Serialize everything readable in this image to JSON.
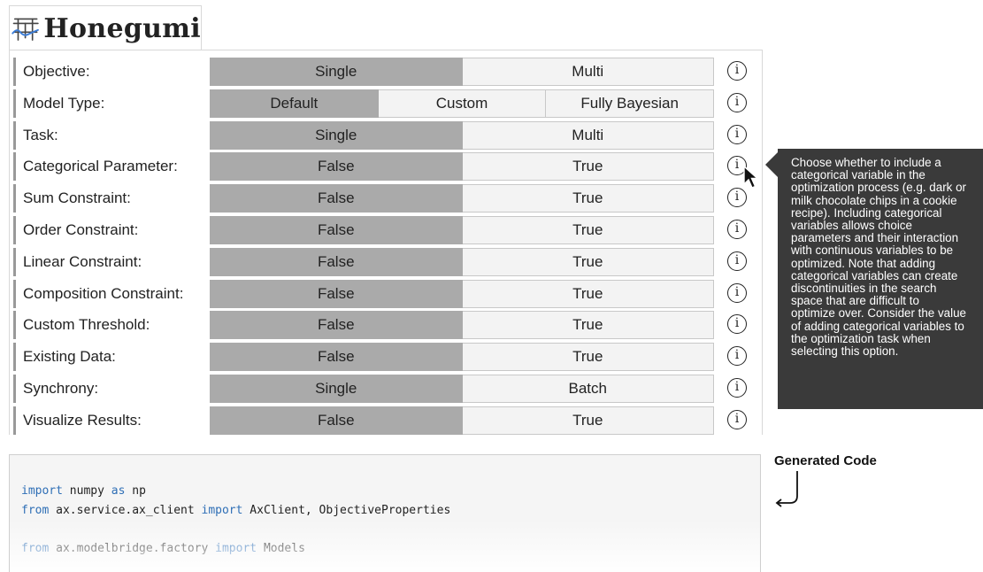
{
  "app": {
    "title": "Honegumi"
  },
  "options": [
    {
      "label": "Objective:",
      "choices": [
        "Single",
        "Multi"
      ],
      "selected": 0
    },
    {
      "label": "Model Type:",
      "choices": [
        "Default",
        "Custom",
        "Fully Bayesian"
      ],
      "selected": 0
    },
    {
      "label": "Task:",
      "choices": [
        "Single",
        "Multi"
      ],
      "selected": 0
    },
    {
      "label": "Categorical Parameter:",
      "choices": [
        "False",
        "True"
      ],
      "selected": 0
    },
    {
      "label": "Sum Constraint:",
      "choices": [
        "False",
        "True"
      ],
      "selected": 0
    },
    {
      "label": "Order Constraint:",
      "choices": [
        "False",
        "True"
      ],
      "selected": 0
    },
    {
      "label": "Linear Constraint:",
      "choices": [
        "False",
        "True"
      ],
      "selected": 0
    },
    {
      "label": "Composition Constraint:",
      "choices": [
        "False",
        "True"
      ],
      "selected": 0
    },
    {
      "label": "Custom Threshold:",
      "choices": [
        "False",
        "True"
      ],
      "selected": 0
    },
    {
      "label": "Existing Data:",
      "choices": [
        "False",
        "True"
      ],
      "selected": 0
    },
    {
      "label": "Synchrony:",
      "choices": [
        "Single",
        "Batch"
      ],
      "selected": 0
    },
    {
      "label": "Visualize Results:",
      "choices": [
        "False",
        "True"
      ],
      "selected": 0
    }
  ],
  "info_icon_glyph": "i",
  "tooltip": {
    "lines": [
      "Choose whether to include a",
      "categorical variable in the",
      "optimization process (e.g. dark or",
      "milk chocolate chips in a cookie",
      "recipe). Including categorical",
      "variables allows choice",
      "parameters and their interaction",
      "with continuous variables to be",
      "optimized. Note that adding",
      "categorical variables can create",
      "discontinuities in the search",
      "space that are difficult to",
      "optimize over. Consider the value",
      "of adding categorical variables to",
      "the optimization task when",
      "selecting this option."
    ]
  },
  "generated_code_label": "Generated Code",
  "code_lines": [
    [
      {
        "t": "import",
        "k": true
      },
      {
        "t": " numpy "
      },
      {
        "t": "as",
        "k": true
      },
      {
        "t": " np"
      }
    ],
    [
      {
        "t": "from",
        "k": true
      },
      {
        "t": " ax.service.ax_client "
      },
      {
        "t": "import",
        "k": true
      },
      {
        "t": " AxClient, ObjectiveProperties"
      }
    ],
    [
      {
        "t": "from",
        "k": true
      },
      {
        "t": " ax.modelbridge.factory "
      },
      {
        "t": "import",
        "k": true
      },
      {
        "t": " Models"
      }
    ]
  ],
  "colors": {
    "selected": "#aaaaaa",
    "unselected": "#f3f3f3",
    "keyword": "#2f6fb6",
    "tooltip_bg": "#3a3a3a"
  }
}
